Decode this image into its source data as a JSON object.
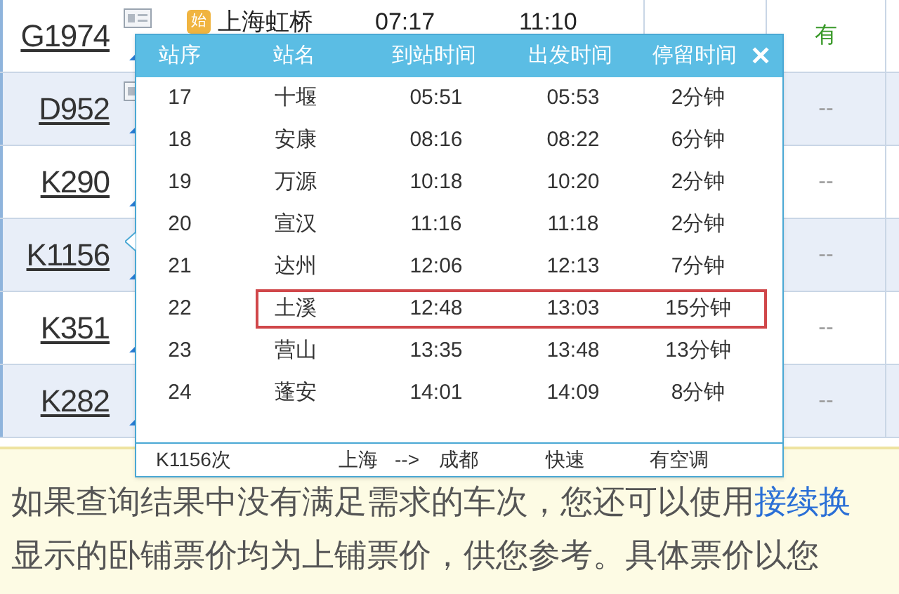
{
  "trains": [
    {
      "number": "G1974",
      "note_icon": true,
      "seat": "有",
      "available": true,
      "origin_badge": "始",
      "origin": "上海虹桥",
      "depart": "07:17",
      "arrive": "11:10"
    },
    {
      "number": "D952",
      "note_icon": true,
      "seat": "--",
      "available": false
    },
    {
      "number": "K290",
      "note_icon": false,
      "seat": "--",
      "available": false
    },
    {
      "number": "K1156",
      "note_icon": false,
      "seat": "--",
      "available": false
    },
    {
      "number": "K351",
      "note_icon": false,
      "seat": "--",
      "available": false
    },
    {
      "number": "K282",
      "note_icon": false,
      "seat": "--",
      "available": false
    }
  ],
  "stops_popup": {
    "columns": [
      "站序",
      "站名",
      "到站时间",
      "出发时间",
      "停留时间"
    ],
    "close": "✕",
    "rows": [
      {
        "seq": "17",
        "station": "十堰",
        "arrive": "05:51",
        "depart": "05:53",
        "stay": "2分钟",
        "highlighted": false
      },
      {
        "seq": "18",
        "station": "安康",
        "arrive": "08:16",
        "depart": "08:22",
        "stay": "6分钟",
        "highlighted": false
      },
      {
        "seq": "19",
        "station": "万源",
        "arrive": "10:18",
        "depart": "10:20",
        "stay": "2分钟",
        "highlighted": false
      },
      {
        "seq": "20",
        "station": "宣汉",
        "arrive": "11:16",
        "depart": "11:18",
        "stay": "2分钟",
        "highlighted": false
      },
      {
        "seq": "21",
        "station": "达州",
        "arrive": "12:06",
        "depart": "12:13",
        "stay": "7分钟",
        "highlighted": false
      },
      {
        "seq": "22",
        "station": "土溪",
        "arrive": "12:48",
        "depart": "13:03",
        "stay": "15分钟",
        "highlighted": true
      },
      {
        "seq": "23",
        "station": "营山",
        "arrive": "13:35",
        "depart": "13:48",
        "stay": "13分钟",
        "highlighted": false
      },
      {
        "seq": "24",
        "station": "蓬安",
        "arrive": "14:01",
        "depart": "14:09",
        "stay": "8分钟",
        "highlighted": false
      }
    ],
    "footer": {
      "train": "K1156次",
      "from": "上海",
      "arrow": "-->",
      "to": "成都",
      "type": "快速",
      "aircon": "有空调"
    }
  },
  "notice": {
    "line_1": "如果查询结果中没有满足需求的车次，您还可以使用",
    "link": "接续换",
    "line_2": "显示的卧铺票价均为上铺票价，供您参考。具体票价以您"
  }
}
